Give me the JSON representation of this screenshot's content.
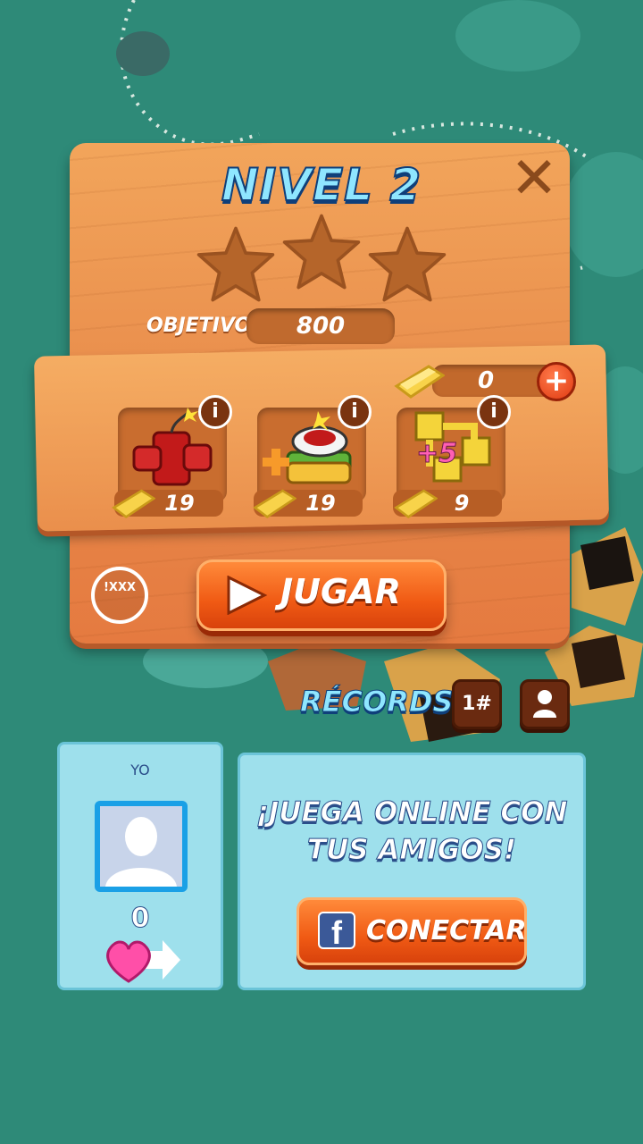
{
  "level": {
    "title": "NIVEL 2",
    "stars_earned": 0,
    "stars_total": 3
  },
  "objective": {
    "label": "OBJETIVO",
    "value": "800"
  },
  "currency": {
    "gold_count": "0",
    "plus_icon": "plus-icon"
  },
  "boosters": [
    {
      "name": "dynamite",
      "price": "19",
      "info": "i"
    },
    {
      "name": "sandwich-bomb",
      "price": "19",
      "info": "i"
    },
    {
      "name": "plus-five-moves",
      "price": "9",
      "info": "i",
      "badge": "+5"
    }
  ],
  "actions": {
    "play_label": "JUGAR",
    "close_icon": "close-icon",
    "check_text": "!XXX"
  },
  "records": {
    "label": "RÉCORDS:",
    "rank_button": "1#",
    "profile_icon": "person-icon"
  },
  "player": {
    "label": "YO",
    "lives": "0"
  },
  "facebook": {
    "line1": "¡JUEGA ONLINE CON",
    "line2": "TUS AMIGOS!",
    "connect_label": "CONECTAR",
    "logo": "f"
  },
  "colors": {
    "panel": "#e88a4a",
    "accent_orange": "#f05a14",
    "title_blue": "#8fe6ff",
    "card_bg": "#9ee0ec",
    "bg": "#2e8a78"
  }
}
